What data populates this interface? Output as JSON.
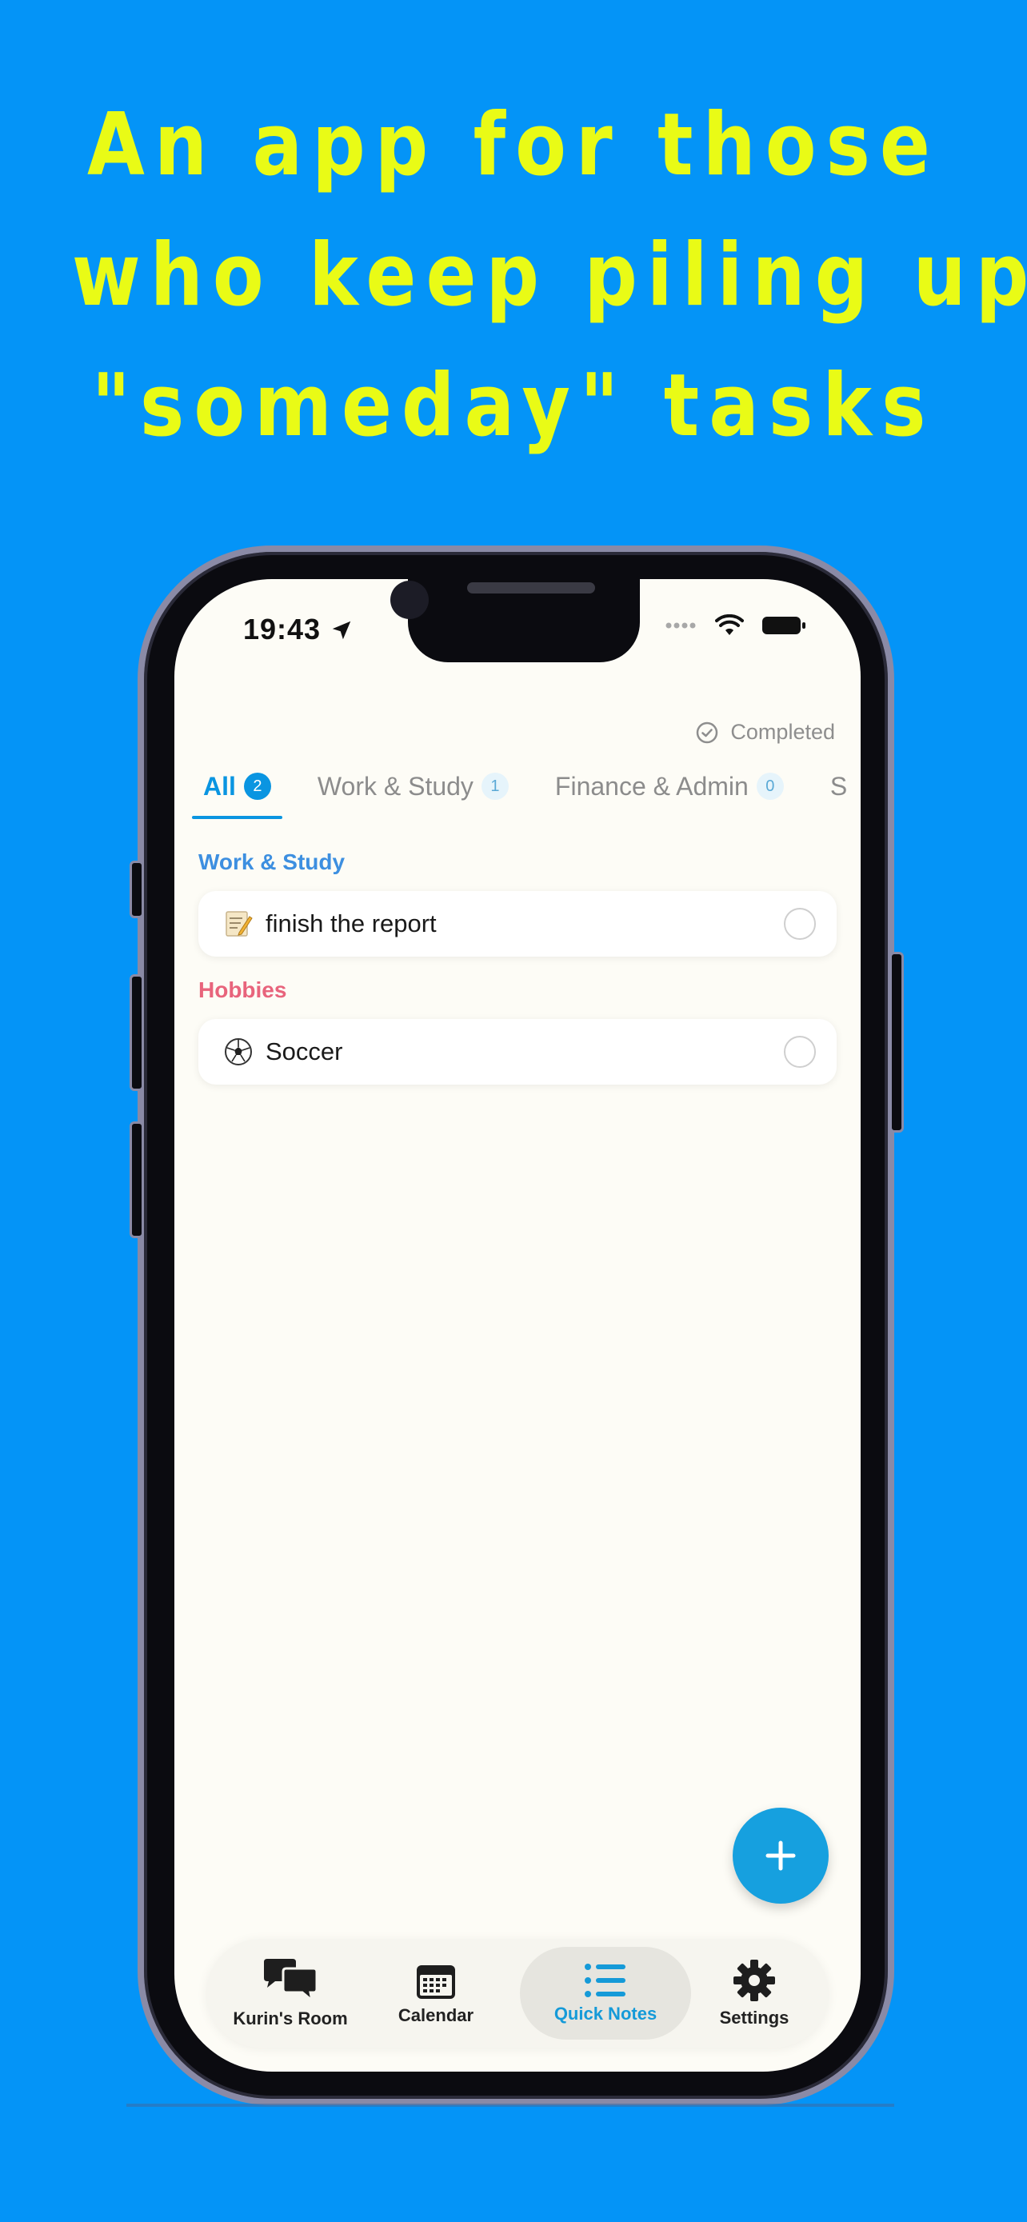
{
  "headline": {
    "line1": "An app for those",
    "line2": "who keep piling up",
    "line3": "\"someday\" tasks"
  },
  "status_bar": {
    "time": "19:43"
  },
  "header": {
    "completed_label": "Completed"
  },
  "tabs": [
    {
      "label": "All",
      "count": "2",
      "active": true
    },
    {
      "label": "Work & Study",
      "count": "1",
      "active": false
    },
    {
      "label": "Finance & Admin",
      "count": "0",
      "active": false
    },
    {
      "label": "S",
      "count": "",
      "active": false
    }
  ],
  "sections": [
    {
      "title": "Work & Study",
      "color": "#3d8fe0",
      "tasks": [
        {
          "emoji_icon": "memo-icon",
          "label": "finish the report"
        }
      ]
    },
    {
      "title": "Hobbies",
      "color": "#e8647c",
      "tasks": [
        {
          "emoji_icon": "soccer-ball-icon",
          "label": "Soccer"
        }
      ]
    }
  ],
  "bottom_nav": [
    {
      "label": "Kurin's Room",
      "icon": "chat-bubbles-icon",
      "active": false
    },
    {
      "label": "Calendar",
      "icon": "calendar-icon",
      "active": false
    },
    {
      "label": "Quick Notes",
      "icon": "list-icon",
      "active": true
    },
    {
      "label": "Settings",
      "icon": "gear-icon",
      "active": false
    }
  ],
  "colors": {
    "background": "#0494f7",
    "headline": "#e9fb16",
    "accent": "#0a95e1"
  }
}
